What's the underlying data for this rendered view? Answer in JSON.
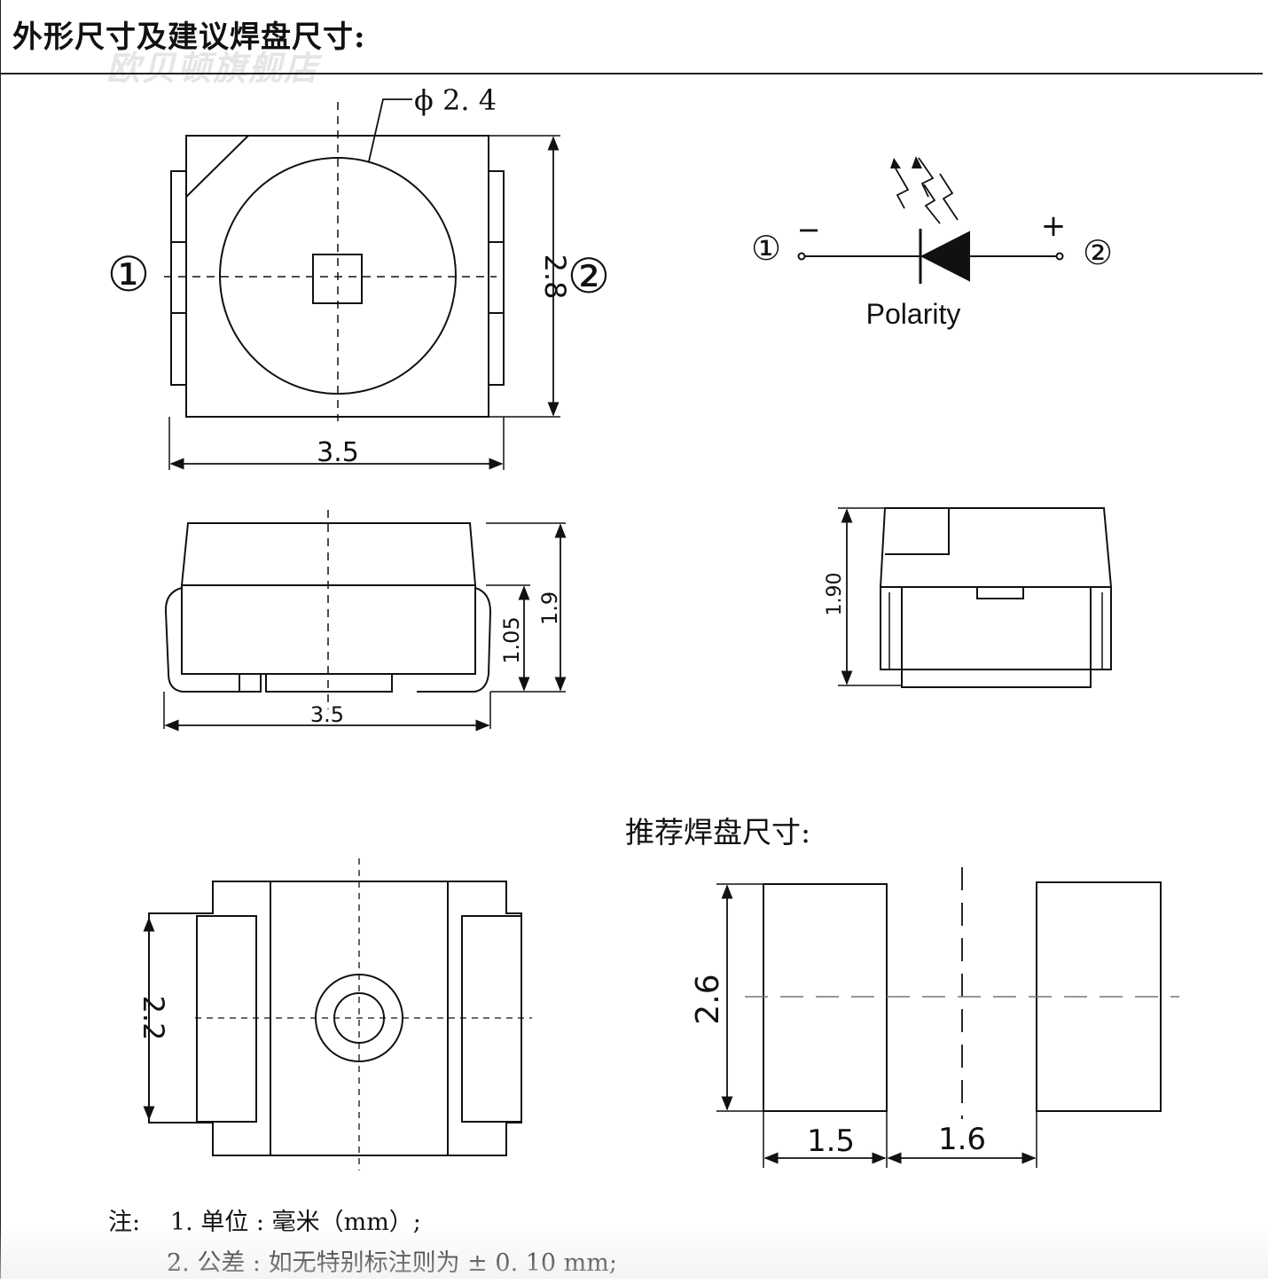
{
  "title": "外形尺寸及建议焊盘尺寸:",
  "watermark": "欧贝顿旗舰店",
  "top_view": {
    "pin1_label": "①",
    "pin2_label": "②",
    "lens_diameter": "ϕ 2. 4",
    "height_dim": "2.8",
    "width_dim": "3.5"
  },
  "polarity": {
    "pin1_label": "①",
    "pin2_label": "②",
    "minus": "−",
    "plus": "+",
    "caption": "Polarity"
  },
  "side_view": {
    "width_dim": "3.5",
    "body_height_dim": "1.05",
    "total_height_dim": "1.9"
  },
  "end_view": {
    "height_dim": "1.90"
  },
  "recommended_pad_title": "推荐焊盘尺寸:",
  "bottom_view": {
    "height_dim": "2.2"
  },
  "pad_layout": {
    "height_dim": "2.6",
    "pad_width_dim": "1.5",
    "gap_dim": "1.6"
  },
  "notes": {
    "prefix": "注:",
    "line1": "1. 单位 : 毫米（mm）;",
    "line2": "2. 公差 : 如无特别标注则为 ± 0. 10 mm;"
  }
}
